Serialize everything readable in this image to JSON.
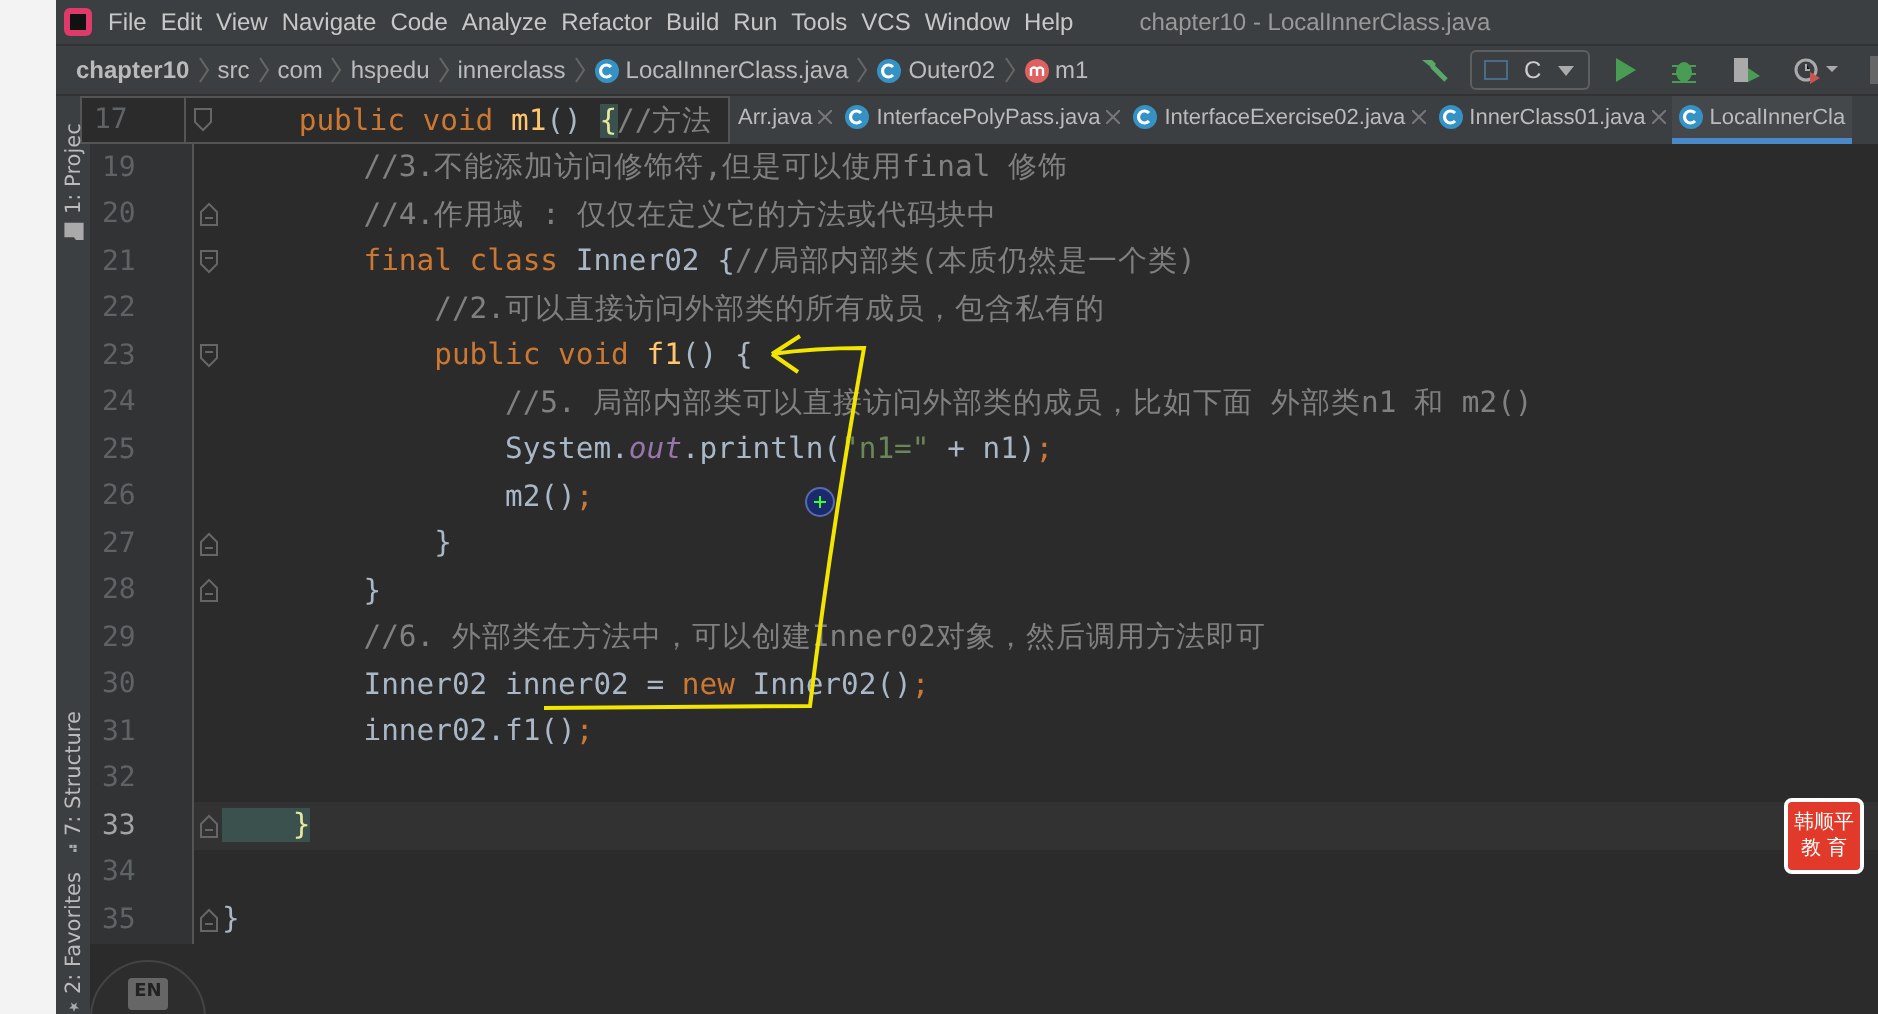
{
  "menu": [
    "File",
    "Edit",
    "View",
    "Navigate",
    "Code",
    "Analyze",
    "Refactor",
    "Build",
    "Run",
    "Tools",
    "VCS",
    "Window",
    "Help"
  ],
  "window": {
    "title": "chapter10 - LocalInnerClass.java"
  },
  "breadcrumb": [
    {
      "label": "chapter10",
      "kind": "project"
    },
    {
      "label": "src",
      "kind": "folder"
    },
    {
      "label": "com",
      "kind": "folder"
    },
    {
      "label": "hspedu",
      "kind": "folder"
    },
    {
      "label": "innerclass",
      "kind": "folder"
    },
    {
      "label": "LocalInnerClass.java",
      "kind": "class"
    },
    {
      "label": "Outer02",
      "kind": "class"
    },
    {
      "label": "m1",
      "kind": "method"
    }
  ],
  "run_config": {
    "label": "C"
  },
  "tabs": [
    {
      "label": "Arr.java",
      "selected": false
    },
    {
      "label": "InterfacePolyPass.java",
      "selected": false
    },
    {
      "label": "InterfaceExercise02.java",
      "selected": false
    },
    {
      "label": "InnerClass01.java",
      "selected": false
    },
    {
      "label": "LocalInnerCla",
      "selected": true
    }
  ],
  "sticky_header": {
    "number": "17",
    "tokens": [
      {
        "kind": "keyword",
        "text": "    public void "
      },
      {
        "kind": "method",
        "text": "m1"
      },
      {
        "kind": "plain",
        "text": "() "
      },
      {
        "kind": "brace",
        "text": "{"
      },
      {
        "kind": "comment",
        "text": "//方法"
      }
    ]
  },
  "tool_windows": [
    {
      "label": "1: Projec",
      "kind": "folder"
    },
    {
      "label": "7: Structure",
      "kind": "structure"
    },
    {
      "label": "2: Favorites",
      "kind": "star"
    }
  ],
  "lines": [
    {
      "number": "19",
      "fold_start": false,
      "fold_end": false,
      "current": false,
      "tokens": [
        {
          "kind": "comment",
          "text": "        //3.不能添加访问修饰符,但是可以使用final 修饰"
        }
      ]
    },
    {
      "number": "20",
      "fold_start": false,
      "fold_end": true,
      "current": false,
      "tokens": [
        {
          "kind": "comment",
          "text": "        //4.作用域 : 仅仅在定义它的方法或代码块中"
        }
      ]
    },
    {
      "number": "21",
      "fold_start": true,
      "fold_end": false,
      "current": false,
      "tokens": [
        {
          "kind": "keyword",
          "text": "        final class "
        },
        {
          "kind": "plain",
          "text": "Inner02 {"
        },
        {
          "kind": "comment",
          "text": "//局部内部类(本质仍然是一个类)"
        }
      ]
    },
    {
      "number": "22",
      "fold_start": false,
      "fold_end": false,
      "current": false,
      "tokens": [
        {
          "kind": "comment",
          "text": "            //2.可以直接访问外部类的所有成员，包含私有的"
        }
      ]
    },
    {
      "number": "23",
      "fold_start": true,
      "fold_end": false,
      "current": false,
      "tokens": [
        {
          "kind": "keyword",
          "text": "            public void "
        },
        {
          "kind": "method",
          "text": "f1"
        },
        {
          "kind": "plain",
          "text": "() {"
        }
      ]
    },
    {
      "number": "24",
      "fold_start": false,
      "fold_end": false,
      "current": false,
      "tokens": [
        {
          "kind": "comment",
          "text": "                //5. 局部内部类可以直接访问外部类的成员，比如下面 外部类n1 和 m2()"
        }
      ]
    },
    {
      "number": "25",
      "fold_start": false,
      "fold_end": false,
      "current": false,
      "tokens": [
        {
          "kind": "plain",
          "text": "                System."
        },
        {
          "kind": "static",
          "text": "out"
        },
        {
          "kind": "plain",
          "text": ".println("
        },
        {
          "kind": "string",
          "text": "\"n1=\""
        },
        {
          "kind": "plain",
          "text": " + n1)"
        },
        {
          "kind": "keyword",
          "text": ";"
        }
      ]
    },
    {
      "number": "26",
      "fold_start": false,
      "fold_end": false,
      "current": false,
      "tokens": [
        {
          "kind": "plain",
          "text": "                m2()"
        },
        {
          "kind": "keyword",
          "text": ";"
        }
      ]
    },
    {
      "number": "27",
      "fold_start": false,
      "fold_end": true,
      "current": false,
      "tokens": [
        {
          "kind": "plain",
          "text": "            }"
        }
      ]
    },
    {
      "number": "28",
      "fold_start": false,
      "fold_end": true,
      "current": false,
      "tokens": [
        {
          "kind": "plain",
          "text": "        }"
        }
      ]
    },
    {
      "number": "29",
      "fold_start": false,
      "fold_end": false,
      "current": false,
      "tokens": [
        {
          "kind": "comment",
          "text": "        //6. 外部类在方法中，可以创建Inner02对象，然后调用方法即可"
        }
      ]
    },
    {
      "number": "30",
      "fold_start": false,
      "fold_end": false,
      "current": false,
      "tokens": [
        {
          "kind": "plain",
          "text": "        Inner02 inner02 = "
        },
        {
          "kind": "keyword",
          "text": "new "
        },
        {
          "kind": "plain",
          "text": "Inner02()"
        },
        {
          "kind": "keyword",
          "text": ";"
        }
      ]
    },
    {
      "number": "31",
      "fold_start": false,
      "fold_end": false,
      "current": false,
      "tokens": [
        {
          "kind": "plain",
          "text": "        inner02.f1()"
        },
        {
          "kind": "keyword",
          "text": ";"
        }
      ]
    },
    {
      "number": "32",
      "fold_start": false,
      "fold_end": false,
      "current": false
    },
    {
      "number": "33",
      "fold_start": false,
      "fold_end": true,
      "current": true,
      "tokens": [
        {
          "kind": "brace",
          "text": "    }"
        }
      ]
    },
    {
      "number": "34",
      "fold_start": false,
      "fold_end": false,
      "current": false
    },
    {
      "number": "35",
      "fold_start": false,
      "fold_end": true,
      "current": false,
      "tokens": [
        {
          "kind": "plain",
          "text": "}"
        }
      ]
    }
  ],
  "ime_badge": {
    "label": "EN"
  },
  "logo": {
    "lines": [
      "韩顺平",
      "教 育"
    ]
  }
}
